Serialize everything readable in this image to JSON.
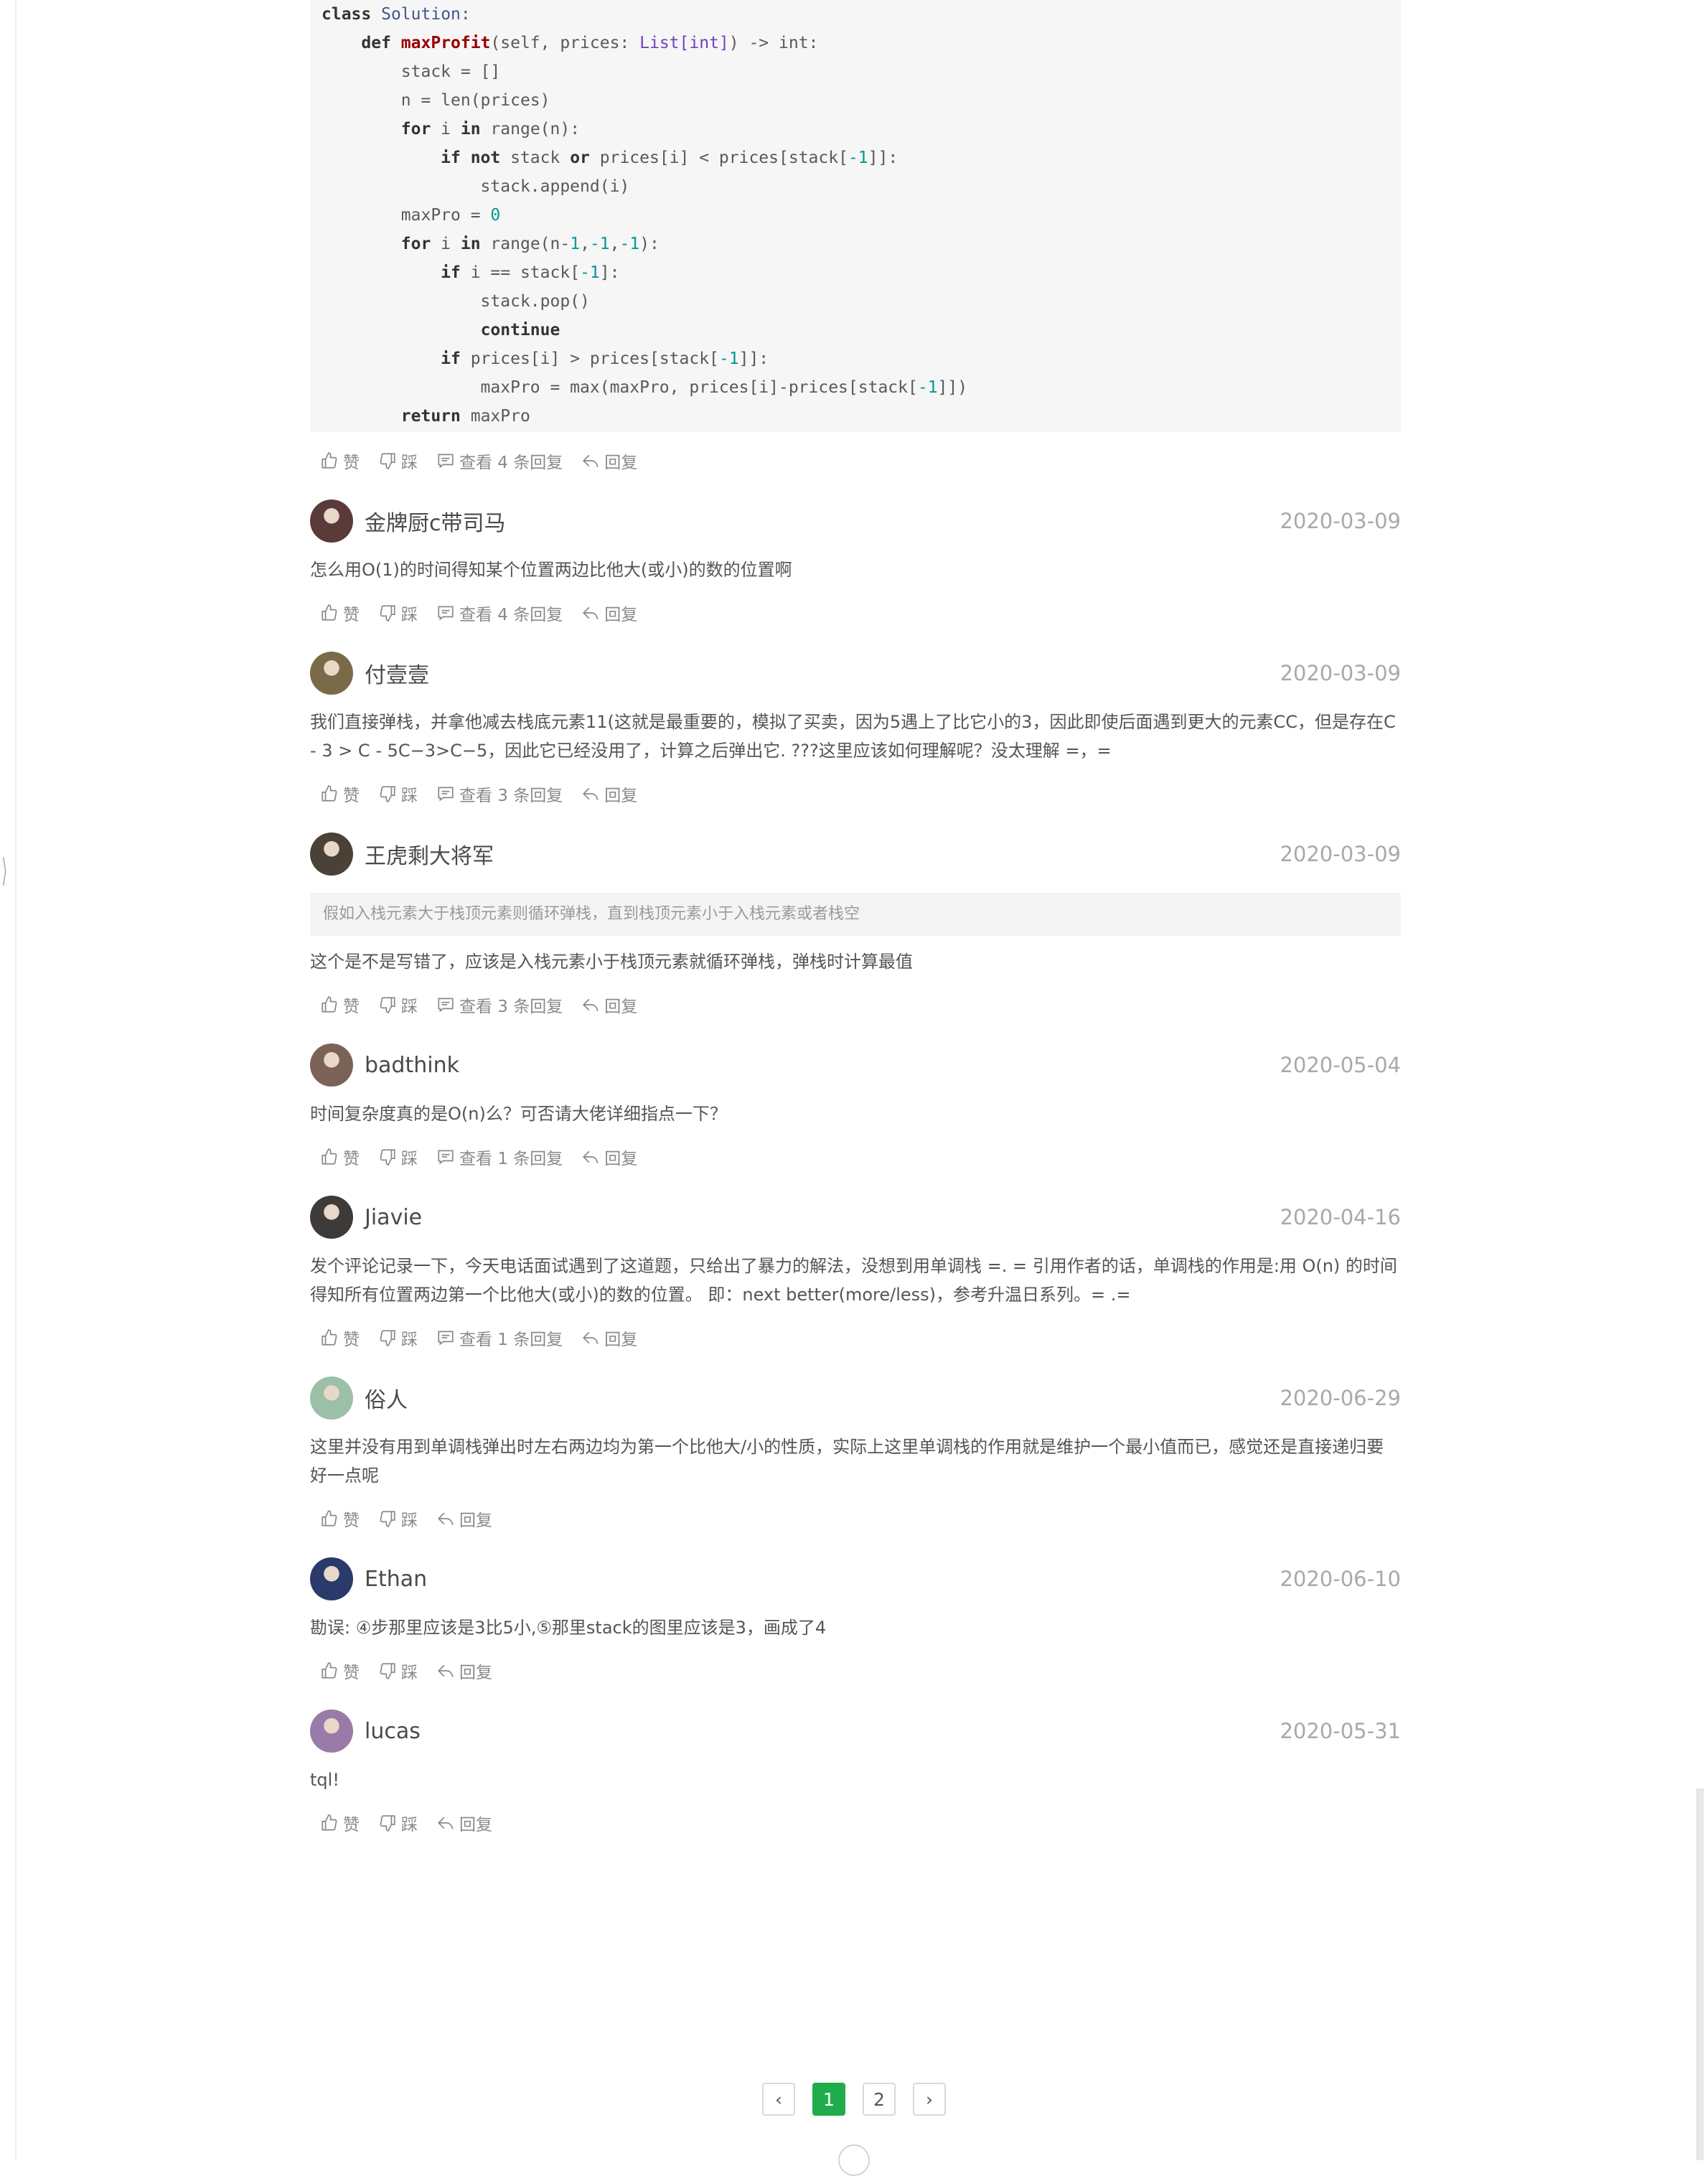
{
  "code": {
    "lines": [
      [
        [
          "kw",
          "class"
        ],
        [
          "",
          " "
        ],
        [
          "cls",
          "Solution"
        ],
        [
          "",
          ":"
        ]
      ],
      [
        [
          "",
          "    "
        ],
        [
          "kw",
          "def"
        ],
        [
          "",
          " "
        ],
        [
          "fn",
          "maxProfit"
        ],
        [
          "",
          "(self, prices: "
        ],
        [
          "ty",
          "List[int]"
        ],
        [
          "",
          ") -> int:"
        ]
      ],
      [
        [
          "",
          "        stack = []"
        ]
      ],
      [
        [
          "",
          "        n = len(prices)"
        ]
      ],
      [
        [
          "",
          "        "
        ],
        [
          "kw",
          "for"
        ],
        [
          "",
          " i "
        ],
        [
          "kw",
          "in"
        ],
        [
          "",
          " range(n):"
        ]
      ],
      [
        [
          "",
          "            "
        ],
        [
          "kw",
          "if not"
        ],
        [
          "",
          " stack "
        ],
        [
          "kw",
          "or"
        ],
        [
          "",
          " prices[i] < prices[stack["
        ],
        [
          "num",
          "-1"
        ],
        [
          "",
          "]]:"
        ]
      ],
      [
        [
          "",
          "                stack.append(i)"
        ]
      ],
      [
        [
          "",
          "        maxPro = "
        ],
        [
          "num",
          "0"
        ]
      ],
      [
        [
          "",
          "        "
        ],
        [
          "kw",
          "for"
        ],
        [
          "",
          " i "
        ],
        [
          "kw",
          "in"
        ],
        [
          "",
          " range(n-"
        ],
        [
          "num",
          "1"
        ],
        [
          "",
          ","
        ],
        [
          "num",
          "-1"
        ],
        [
          "",
          ","
        ],
        [
          "num",
          "-1"
        ],
        [
          "",
          "):"
        ]
      ],
      [
        [
          "",
          "            "
        ],
        [
          "kw",
          "if"
        ],
        [
          "",
          " i == stack["
        ],
        [
          "num",
          "-1"
        ],
        [
          "",
          "]:"
        ]
      ],
      [
        [
          "",
          "                stack.pop()"
        ]
      ],
      [
        [
          "",
          "                "
        ],
        [
          "kw",
          "continue"
        ]
      ],
      [
        [
          "",
          "            "
        ],
        [
          "kw",
          "if"
        ],
        [
          "",
          " prices[i] > prices[stack["
        ],
        [
          "num",
          "-1"
        ],
        [
          "",
          "]]:"
        ]
      ],
      [
        [
          "",
          "                maxPro = max(maxPro, prices[i]-prices[stack["
        ],
        [
          "num",
          "-1"
        ],
        [
          "",
          "]])"
        ]
      ],
      [
        [
          "",
          "        "
        ],
        [
          "kw",
          "return"
        ],
        [
          "",
          " maxPro"
        ]
      ]
    ]
  },
  "labels": {
    "like": "赞",
    "dislike": "踩",
    "reply": "回复"
  },
  "first_actions": {
    "view_replies": "查看 4 条回复"
  },
  "comments": [
    {
      "username": "金牌厨c带司马",
      "date": "2020-03-09",
      "text": "怎么用O(1)的时间得知某个位置两边比他大(或小)的数的位置啊",
      "view_replies": "查看 4 条回复",
      "avatar_color": "#5b3a3a"
    },
    {
      "username": "付壹壹",
      "date": "2020-03-09",
      "text": "我们直接弹栈，并拿他减去栈底元素11(这就是最重要的，模拟了买卖，因为5遇上了比它小的3，因此即使后面遇到更大的元素CC，但是存在C - 3 > C - 5C−3>C−5，因此它已经没用了，计算之后弹出它. ???这里应该如何理解呢？没太理解 =，=",
      "view_replies": "查看 3 条回复",
      "avatar_color": "#7a6a48"
    },
    {
      "username": "王虎剩大将军",
      "date": "2020-03-09",
      "quote": "假如入栈元素大于栈顶元素则循环弹栈，直到栈顶元素小于入栈元素或者栈空",
      "text": "这个是不是写错了，应该是入栈元素小于栈顶元素就循环弹栈，弹栈时计算最值",
      "view_replies": "查看 3 条回复",
      "avatar_color": "#4a4236"
    },
    {
      "username": "badthink",
      "date": "2020-05-04",
      "text": "时间复杂度真的是O(n)么？可否请大佬详细指点一下？",
      "view_replies": "查看 1 条回复",
      "avatar_color": "#7b6257"
    },
    {
      "username": "Jiavie",
      "date": "2020-04-16",
      "text": "发个评论记录一下，今天电话面试遇到了这道题，只给出了暴力的解法，没想到用单调栈 =. = 引用作者的话，单调栈的作用是:用 O(n) 的时间得知所有位置两边第一个比他大(或小)的数的位置。 即：next better(more/less)，参考升温日系列。= .=",
      "view_replies": "查看 1 条回复",
      "avatar_color": "#3f3a3a"
    },
    {
      "username": "俗人",
      "date": "2020-06-29",
      "text": "这里并没有用到单调栈弹出时左右两边均为第一个比他大/小的性质，实际上这里单调栈的作用就是维护一个最小值而已，感觉还是直接递归要好一点呢",
      "avatar_color": "#9cbfa8"
    },
    {
      "username": "Ethan",
      "date": "2020-06-10",
      "text": "勘误: ④步那里应该是3比5小,⑤那里stack的图里应该是3，画成了4",
      "avatar_color": "#2a3a6a"
    },
    {
      "username": "lucas",
      "date": "2020-05-31",
      "text": "tql!",
      "avatar_color": "#9a7aa8"
    }
  ],
  "pagination": {
    "prev": "‹",
    "pages": [
      "1",
      "2"
    ],
    "current": "1",
    "next": "›"
  },
  "colors": {
    "accent": "#1fad4b",
    "date": "#a9a9a9",
    "action": "#8a8a8a"
  }
}
